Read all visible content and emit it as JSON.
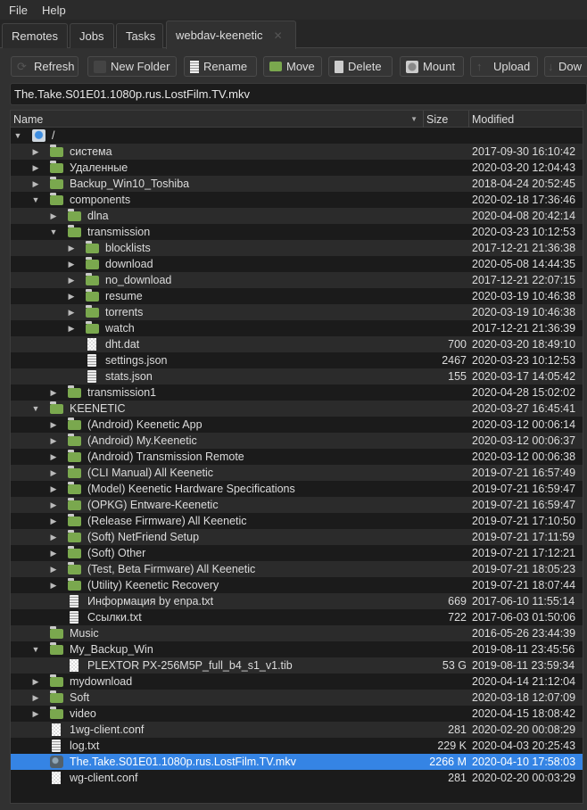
{
  "menu": {
    "file": "File",
    "help": "Help"
  },
  "tabs": [
    {
      "label": "Remotes"
    },
    {
      "label": "Jobs"
    },
    {
      "label": "Tasks"
    },
    {
      "label": "webdav-keenetic",
      "active": true,
      "close": "✕"
    }
  ],
  "toolbar": [
    {
      "label": "Refresh",
      "icon": "refresh-icon"
    },
    {
      "label": "New Folder",
      "icon": "new-folder-icon"
    },
    {
      "label": "Rename",
      "icon": "rename-icon"
    },
    {
      "label": "Move",
      "icon": "folder-icon"
    },
    {
      "label": "Delete",
      "icon": "trash-icon"
    },
    {
      "label": "Mount",
      "icon": "drive-icon"
    },
    {
      "label": "Upload",
      "icon": "upload-icon"
    },
    {
      "label": "Dow",
      "icon": "download-icon"
    }
  ],
  "path": "The.Take.S01E01.1080p.rus.LostFilm.TV.mkv",
  "columns": {
    "name": "Name",
    "size": "Size",
    "modified": "Modified"
  },
  "rows": [
    {
      "d": 0,
      "t": "root",
      "e": "open",
      "name": "/",
      "size": "",
      "mod": ""
    },
    {
      "d": 1,
      "t": "folder",
      "e": "closed",
      "name": "система",
      "size": "",
      "mod": "2017-09-30 16:10:42"
    },
    {
      "d": 1,
      "t": "folder",
      "e": "closed",
      "name": "Удаленные",
      "size": "",
      "mod": "2020-03-20 12:04:43"
    },
    {
      "d": 1,
      "t": "folder",
      "e": "closed",
      "name": "Backup_Win10_Toshiba",
      "size": "",
      "mod": "2018-04-24 20:52:45"
    },
    {
      "d": 1,
      "t": "folder",
      "e": "open",
      "name": "components",
      "size": "",
      "mod": "2020-02-18 17:36:46"
    },
    {
      "d": 2,
      "t": "folder",
      "e": "closed",
      "name": "dlna",
      "size": "",
      "mod": "2020-04-08 20:42:14"
    },
    {
      "d": 2,
      "t": "folder",
      "e": "open",
      "name": "transmission",
      "size": "",
      "mod": "2020-03-23 10:12:53"
    },
    {
      "d": 3,
      "t": "folder",
      "e": "closed",
      "name": "blocklists",
      "size": "",
      "mod": "2017-12-21 21:36:38"
    },
    {
      "d": 3,
      "t": "folder",
      "e": "closed",
      "name": "download",
      "size": "",
      "mod": "2020-05-08 14:44:35"
    },
    {
      "d": 3,
      "t": "folder",
      "e": "closed",
      "name": "no_download",
      "size": "",
      "mod": "2017-12-21 22:07:15"
    },
    {
      "d": 3,
      "t": "folder",
      "e": "closed",
      "name": "resume",
      "size": "",
      "mod": "2020-03-19 10:46:38"
    },
    {
      "d": 3,
      "t": "folder",
      "e": "closed",
      "name": "torrents",
      "size": "",
      "mod": "2020-03-19 10:46:38"
    },
    {
      "d": 3,
      "t": "folder",
      "e": "closed",
      "name": "watch",
      "size": "",
      "mod": "2017-12-21 21:36:39"
    },
    {
      "d": 3,
      "t": "chk",
      "name": "dht.dat",
      "size": "700",
      "mod": "2020-03-20 18:49:10"
    },
    {
      "d": 3,
      "t": "doc",
      "name": "settings.json",
      "size": "2467",
      "mod": "2020-03-23 10:12:53"
    },
    {
      "d": 3,
      "t": "doc",
      "name": "stats.json",
      "size": "155",
      "mod": "2020-03-17 14:05:42"
    },
    {
      "d": 2,
      "t": "folder",
      "e": "closed",
      "name": "transmission1",
      "size": "",
      "mod": "2020-04-28 15:02:02"
    },
    {
      "d": 1,
      "t": "folder",
      "e": "open",
      "name": "KEENETIC",
      "size": "",
      "mod": "2020-03-27 16:45:41"
    },
    {
      "d": 2,
      "t": "folder",
      "e": "closed",
      "name": "(Android) Keenetic App",
      "size": "",
      "mod": "2020-03-12 00:06:14"
    },
    {
      "d": 2,
      "t": "folder",
      "e": "closed",
      "name": "(Android) My.Keenetic",
      "size": "",
      "mod": "2020-03-12 00:06:37"
    },
    {
      "d": 2,
      "t": "folder",
      "e": "closed",
      "name": "(Android) Transmission Remote",
      "size": "",
      "mod": "2020-03-12 00:06:38"
    },
    {
      "d": 2,
      "t": "folder",
      "e": "closed",
      "name": "(CLI Manual) All Keenetic",
      "size": "",
      "mod": "2019-07-21 16:57:49"
    },
    {
      "d": 2,
      "t": "folder",
      "e": "closed",
      "name": "(Model) Keenetic Hardware Specifications",
      "size": "",
      "mod": "2019-07-21 16:59:47"
    },
    {
      "d": 2,
      "t": "folder",
      "e": "closed",
      "name": "(OPKG) Entware-Keenetic",
      "size": "",
      "mod": "2019-07-21 16:59:47"
    },
    {
      "d": 2,
      "t": "folder",
      "e": "closed",
      "name": "(Release Firmware) All Keenetic",
      "size": "",
      "mod": "2019-07-21 17:10:50"
    },
    {
      "d": 2,
      "t": "folder",
      "e": "closed",
      "name": "(Soft) NetFriend Setup",
      "size": "",
      "mod": "2019-07-21 17:11:59"
    },
    {
      "d": 2,
      "t": "folder",
      "e": "closed",
      "name": "(Soft) Other",
      "size": "",
      "mod": "2019-07-21 17:12:21"
    },
    {
      "d": 2,
      "t": "folder",
      "e": "closed",
      "name": "(Test, Beta Firmware) All Keenetic",
      "size": "",
      "mod": "2019-07-21 18:05:23"
    },
    {
      "d": 2,
      "t": "folder",
      "e": "closed",
      "name": "(Utility) Keenetic Recovery",
      "size": "",
      "mod": "2019-07-21 18:07:44"
    },
    {
      "d": 2,
      "t": "doc",
      "name": "Информация by enpa.txt",
      "size": "669",
      "mod": "2017-06-10 11:55:14"
    },
    {
      "d": 2,
      "t": "doc",
      "name": "Ссылки.txt",
      "size": "722",
      "mod": "2017-06-03 01:50:06"
    },
    {
      "d": 1,
      "t": "folder",
      "e": "none",
      "name": "Music",
      "size": "",
      "mod": "2016-05-26 23:44:39"
    },
    {
      "d": 1,
      "t": "folder",
      "e": "open",
      "name": "My_Backup_Win",
      "size": "",
      "mod": "2019-08-11 23:45:56"
    },
    {
      "d": 2,
      "t": "chk",
      "name": "PLEXTOR PX-256M5P_full_b4_s1_v1.tib",
      "size": "53 G",
      "mod": "2019-08-11 23:59:34"
    },
    {
      "d": 1,
      "t": "folder",
      "e": "closed",
      "name": "mydownload",
      "size": "",
      "mod": "2020-04-14 21:12:04"
    },
    {
      "d": 1,
      "t": "folder",
      "e": "closed",
      "name": "Soft",
      "size": "",
      "mod": "2020-03-18 12:07:09"
    },
    {
      "d": 1,
      "t": "folder",
      "e": "closed",
      "name": "video",
      "size": "",
      "mod": "2020-04-15 18:08:42"
    },
    {
      "d": 1,
      "t": "chk",
      "name": "1wg-client.conf",
      "size": "281",
      "mod": "2020-02-20 00:08:29"
    },
    {
      "d": 1,
      "t": "doc",
      "name": "log.txt",
      "size": "229 K",
      "mod": "2020-04-03 20:25:43"
    },
    {
      "d": 1,
      "t": "film",
      "name": "The.Take.S01E01.1080p.rus.LostFilm.TV.mkv",
      "size": "2266 M",
      "mod": "2020-04-10 17:58:03",
      "selected": true
    },
    {
      "d": 1,
      "t": "chk",
      "name": "wg-client.conf",
      "size": "281",
      "mod": "2020-02-20 00:03:29"
    }
  ],
  "colors": {
    "selection": "#3584e4",
    "folder": "#7aa84e"
  }
}
